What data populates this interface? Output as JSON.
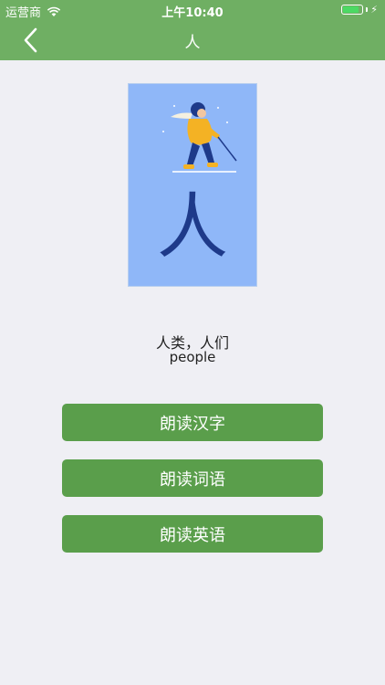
{
  "status_bar": {
    "carrier": "运营商",
    "time": "上午10:40",
    "battery_level": 0.85,
    "wifi_icon": "wifi-icon",
    "bolt_icon": "⚡"
  },
  "nav": {
    "back_icon": "chevron-left-icon",
    "title": "人"
  },
  "card": {
    "character": "人",
    "background": "#8FB7F8",
    "illustration": "skier-illustration"
  },
  "word": {
    "meaning_cn": "人类，人们",
    "meaning_en": "people"
  },
  "buttons": {
    "read_char": "朗读汉字",
    "read_word": "朗读词语",
    "read_english": "朗读英语"
  },
  "colors": {
    "header": "#6FAF63",
    "button": "#5A9E4B",
    "background": "#EFEFF4"
  }
}
